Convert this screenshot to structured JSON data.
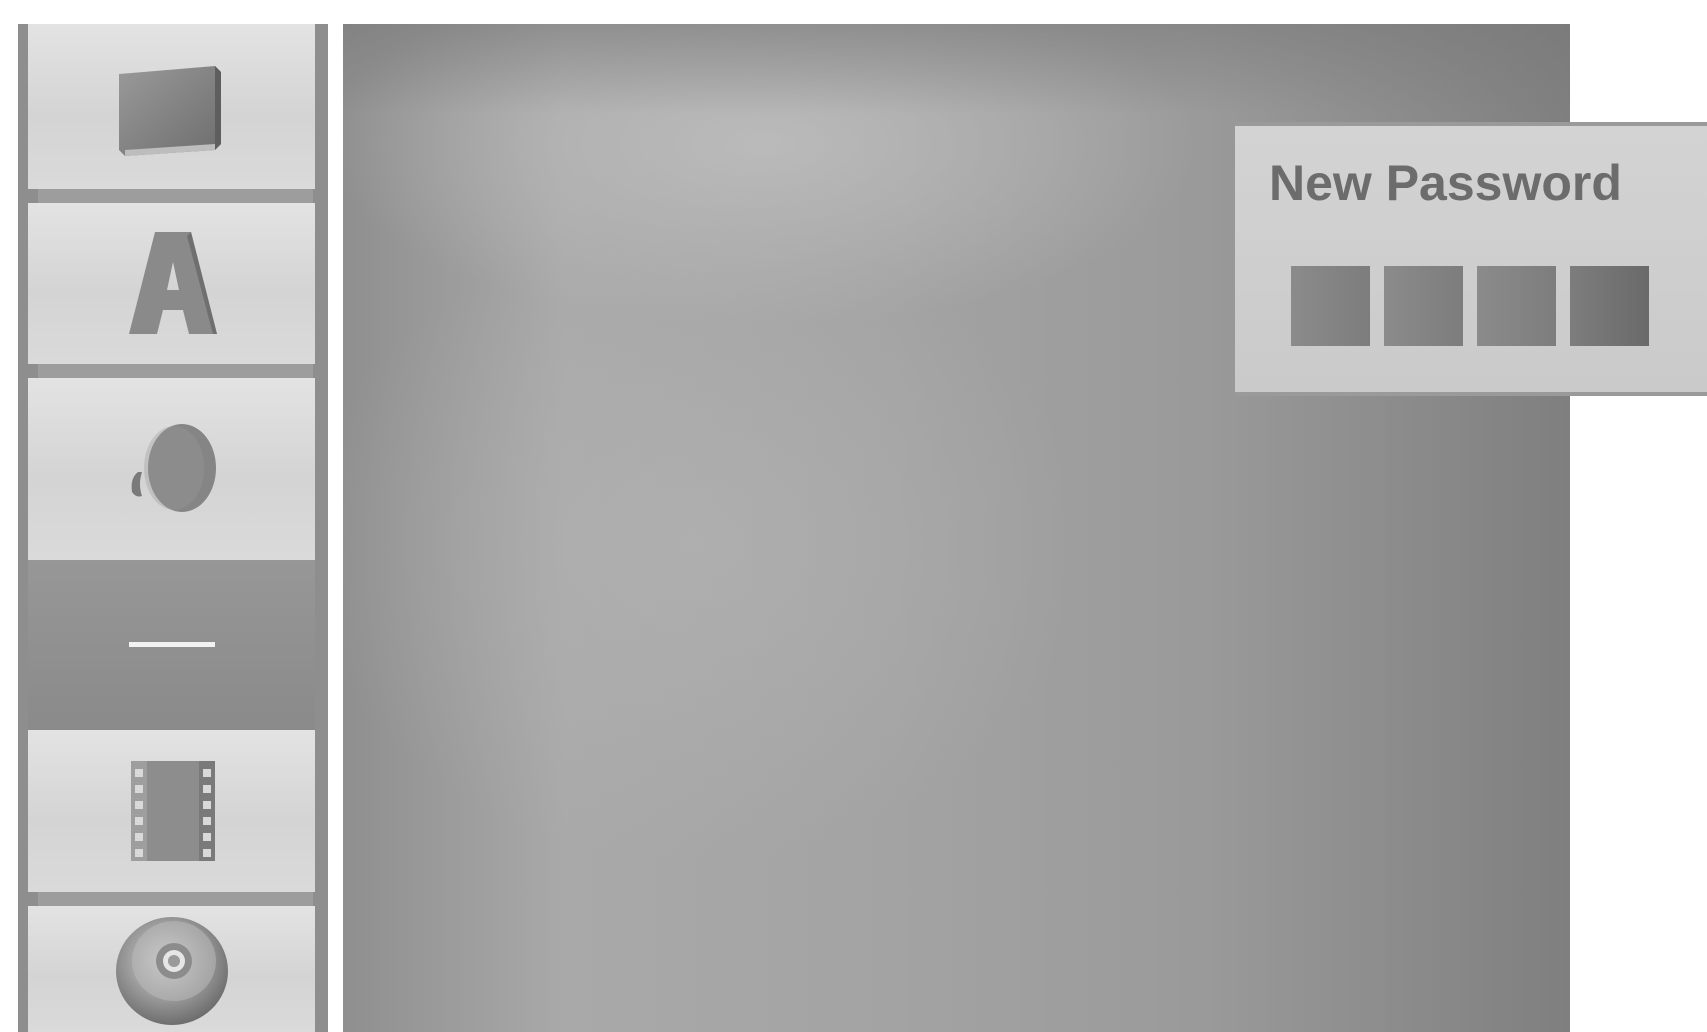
{
  "dialog": {
    "title": "New Password",
    "digit_slots": 4
  },
  "sidebar": {
    "items": [
      {
        "icon": "disc-tray-icon",
        "selected": false
      },
      {
        "icon": "language-a-icon",
        "selected": false
      },
      {
        "icon": "speaker-icon",
        "selected": false
      },
      {
        "icon": "lock-dash-icon",
        "selected": true
      },
      {
        "icon": "film-strip-icon",
        "selected": false
      },
      {
        "icon": "disc-icon",
        "selected": false
      }
    ]
  },
  "colors": {
    "panel": "#a0a0a0",
    "sidebar_item": "#dcdcdc",
    "sidebar_selected": "#8e8e8e",
    "dialog": "#cfcfcf",
    "dialog_text": "#6c6c6c",
    "digit_box": "#828282"
  }
}
